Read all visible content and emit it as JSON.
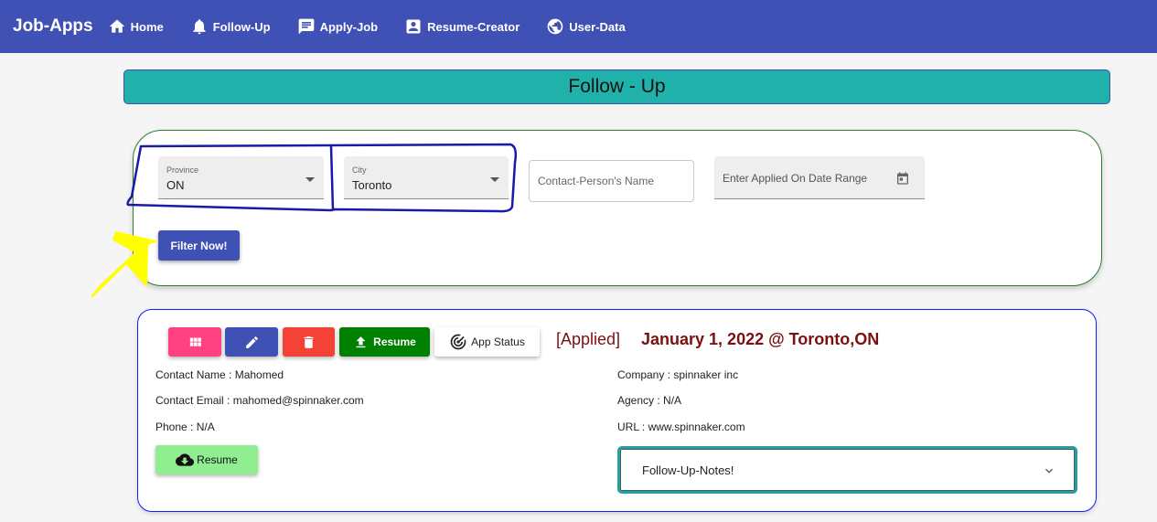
{
  "navbar": {
    "brand": "Job-Apps",
    "items": [
      {
        "label": "Home",
        "icon": "home-icon"
      },
      {
        "label": "Follow-Up",
        "icon": "bell-icon"
      },
      {
        "label": "Apply-Job",
        "icon": "message-icon"
      },
      {
        "label": "Resume-Creator",
        "icon": "contact-card-icon"
      },
      {
        "label": "User-Data",
        "icon": "data-usage-icon"
      }
    ]
  },
  "page_title": "Follow - Up",
  "filters": {
    "province": {
      "label": "Province",
      "value": "ON"
    },
    "city": {
      "label": "City",
      "value": "Toronto"
    },
    "contact_placeholder": "Contact-Person's Name",
    "date_placeholder": "Enter Applied On Date Range",
    "filter_button": "Filter Now!"
  },
  "job": {
    "actions": {
      "upload_resume": "Resume",
      "app_status": "App Status"
    },
    "status": "[Applied]",
    "date_location": "January 1, 2022 @ Toronto,ON",
    "contact_name": "Contact Name : Mahomed",
    "contact_email": "Contact Email : mahomed@spinnaker.com",
    "phone": "Phone : N/A",
    "company": "Company : spinnaker inc",
    "agency": "Agency : N/A",
    "url": "URL : www.spinnaker.com",
    "download_resume": "Resume",
    "notes_title": "Follow-Up-Notes!"
  },
  "colors": {
    "primary": "#3f51b5",
    "title_bar": "#20b2aa",
    "grid_button": "#ff4081",
    "delete_button": "#f44336",
    "upload_button": "#008000",
    "download_button": "#90ee90",
    "status_text": "#7b1010"
  }
}
